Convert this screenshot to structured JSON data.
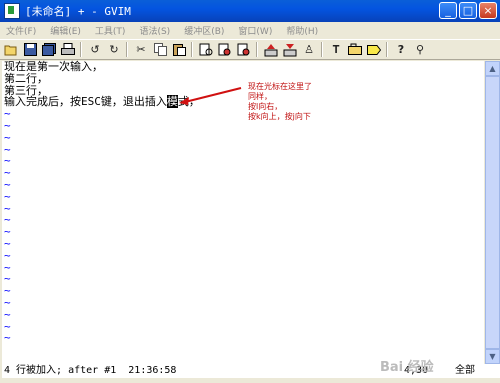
{
  "window": {
    "title": "[未命名] + - GVIM"
  },
  "menu": {
    "items": [
      "文件(F)",
      "编辑(E)",
      "工具(T)",
      "语法(S)",
      "缓冲区(B)",
      "窗口(W)",
      "帮助(H)"
    ]
  },
  "toolbar": {
    "icons": [
      "open-icon",
      "save-icon",
      "save-all-icon",
      "print-icon",
      "undo-icon",
      "redo-icon",
      "cut-icon",
      "copy-icon",
      "paste-icon",
      "replace-icon",
      "find-next-icon",
      "find-prev-icon",
      "load-session-icon",
      "save-session-icon",
      "run-script-icon",
      "make-icon",
      "shell-icon",
      "ctags-icon",
      "help-icon",
      "find-help-icon"
    ]
  },
  "editor": {
    "lines": [
      "现在是第一次输入，",
      "第二行，",
      "第三行，"
    ],
    "line4_before": "输入完成后，按ESC键，退出插入",
    "line4_cursor": "模",
    "line4_after": "式，",
    "tilde": "~",
    "tilde_count": 20
  },
  "annotation": {
    "lines": [
      "现在光标在这里了",
      "同样，",
      "按l向右，",
      "按k向上，按j向下"
    ]
  },
  "statusline": {
    "message": "4 行被加入; after #1  21:36:58",
    "position": "4,30",
    "scroll": "全部"
  },
  "watermark": {
    "text": "Bai 经验"
  }
}
